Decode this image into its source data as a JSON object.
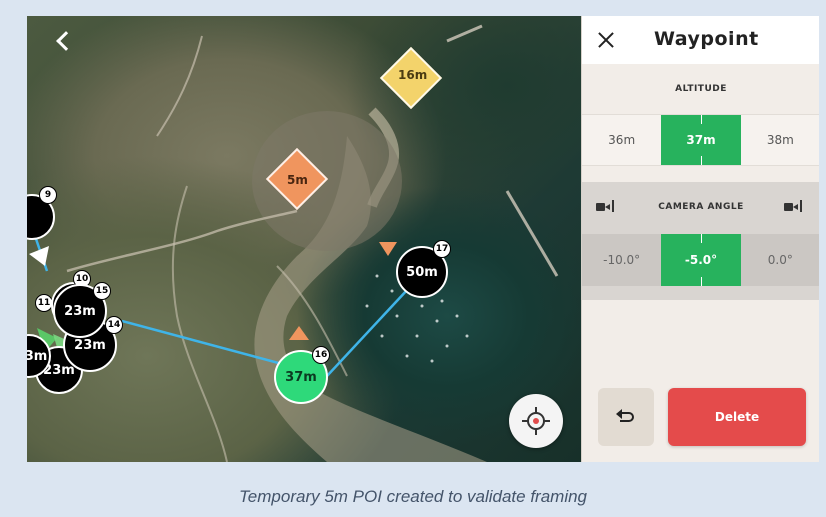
{
  "map": {
    "waypoints": [
      {
        "label": "",
        "badge": "9"
      },
      {
        "label": "50m",
        "badge": "17"
      },
      {
        "label": "23m",
        "badge": "15"
      },
      {
        "label": "23m",
        "badge": "14"
      },
      {
        "label": "23m",
        "badge": ""
      },
      {
        "label": "3m",
        "badge": "11"
      },
      {
        "label": "",
        "badge": "10"
      },
      {
        "label": "37m",
        "badge": "16"
      }
    ],
    "pois": [
      {
        "label": "16m",
        "color": "#f3d36b"
      },
      {
        "label": "5m",
        "color": "#f0955e"
      }
    ],
    "colors": {
      "route": "#3fb4e8",
      "poi_marker": "#f0955e",
      "selected": "#2ed97a"
    }
  },
  "panel": {
    "title": "Waypoint",
    "altitude": {
      "label": "ALTITUDE",
      "options": [
        "36m",
        "37m",
        "38m"
      ]
    },
    "camera_angle": {
      "label": "CAMERA ANGLE",
      "options": [
        "-10.0°",
        "-5.0°",
        "0.0°"
      ]
    },
    "delete_label": "Delete"
  },
  "caption": "Temporary 5m POI created to validate framing"
}
